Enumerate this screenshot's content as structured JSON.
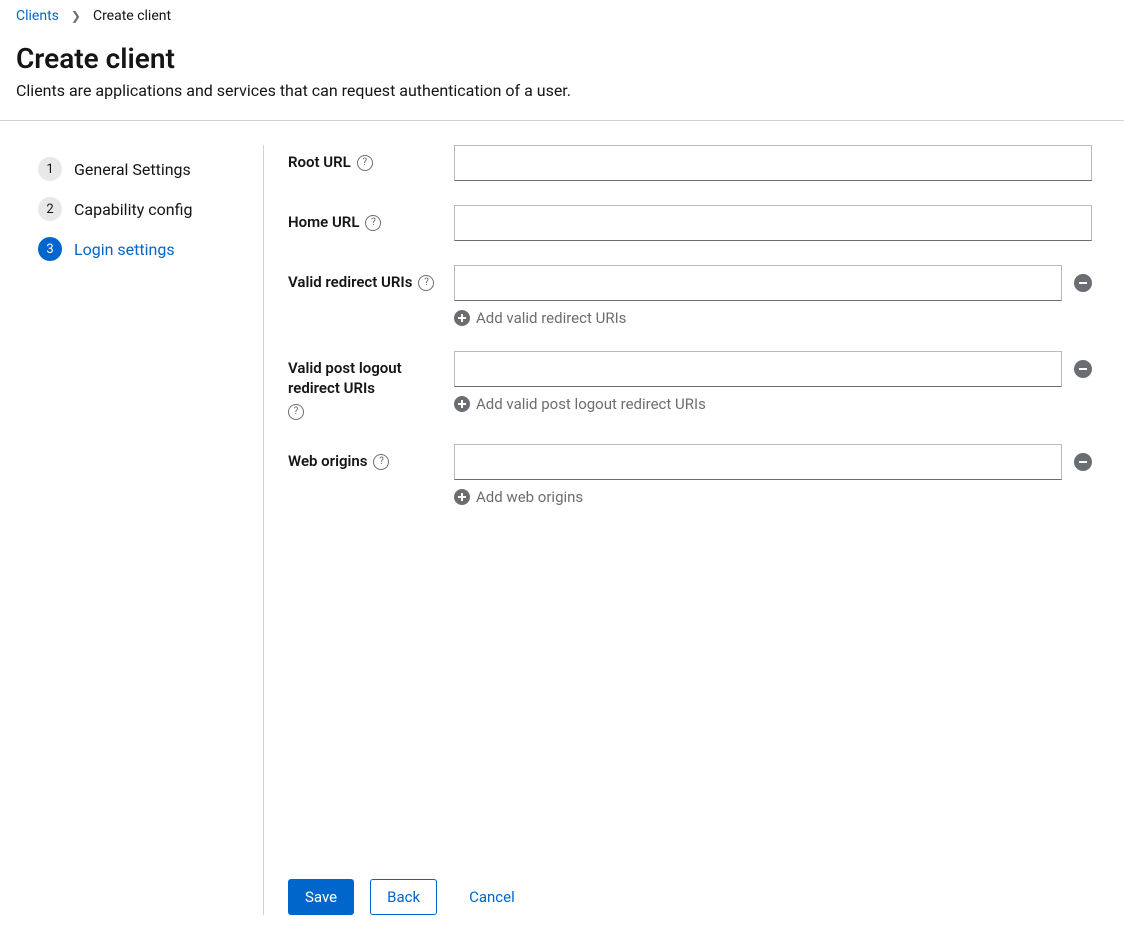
{
  "breadcrumb": {
    "parent": "Clients",
    "current": "Create client"
  },
  "page": {
    "title": "Create client",
    "description": "Clients are applications and services that can request authentication of a user."
  },
  "wizard": {
    "steps": [
      {
        "num": "1",
        "label": "General Settings"
      },
      {
        "num": "2",
        "label": "Capability config"
      },
      {
        "num": "3",
        "label": "Login settings"
      }
    ],
    "currentIndex": 2
  },
  "form": {
    "rootUrl": {
      "label": "Root URL",
      "value": ""
    },
    "homeUrl": {
      "label": "Home URL",
      "value": ""
    },
    "validRedirectUris": {
      "label": "Valid redirect URIs",
      "addLabel": "Add valid redirect URIs",
      "value": ""
    },
    "validPostLogoutRedirectUris": {
      "label": "Valid post logout redirect URIs",
      "addLabel": "Add valid post logout redirect URIs",
      "value": ""
    },
    "webOrigins": {
      "label": "Web origins",
      "addLabel": "Add web origins",
      "value": ""
    }
  },
  "footer": {
    "save": "Save",
    "back": "Back",
    "cancel": "Cancel"
  }
}
